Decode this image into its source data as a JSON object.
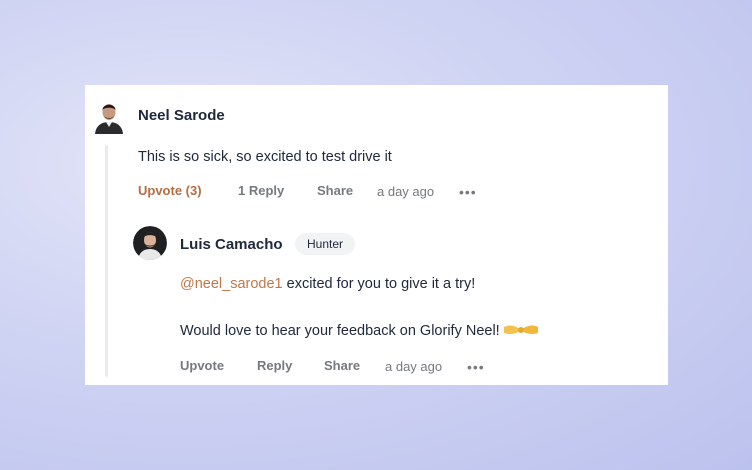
{
  "comment": {
    "author": "Neel Sarode",
    "body": "This is so sick, so excited to test drive it",
    "upvote_label": "Upvote (3)",
    "reply_label": "1 Reply",
    "share_label": "Share",
    "timestamp": "a day ago",
    "more_icon": "more-dots-icon"
  },
  "reply": {
    "author": "Luis Camacho",
    "badge": "Hunter",
    "mention": "@neel_sarode1",
    "body_line1_rest": " excited for you to give it a try!",
    "body_line2": "Would love to hear your feedback on Glorify Neel!",
    "emoji_icon": "handshake-icon",
    "upvote_label": "Upvote",
    "reply_label": "Reply",
    "share_label": "Share",
    "timestamp": "a day ago",
    "more_icon": "more-dots-icon"
  },
  "colors": {
    "upvoted": "#b26f43",
    "mention": "#c0784b",
    "muted": "#76797f",
    "text": "#21293c"
  }
}
